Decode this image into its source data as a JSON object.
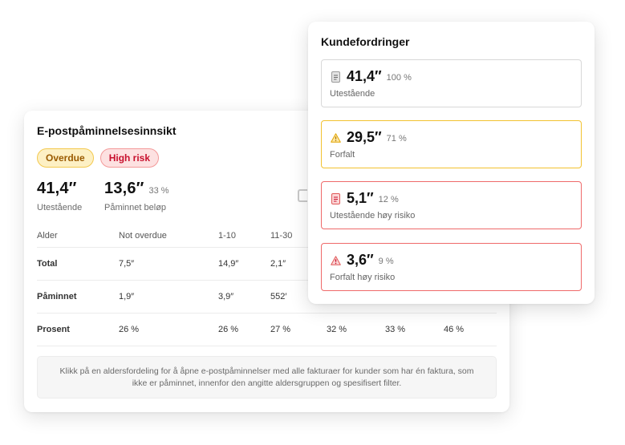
{
  "reminder_card": {
    "title": "E-postpåminnelsesinnsikt",
    "badges": {
      "overdue": "Overdue",
      "high_risk": "High risk"
    },
    "stats": [
      {
        "value": "41,4″",
        "pct": "",
        "label": "Utestående"
      },
      {
        "value": "13,6″",
        "pct": "33 %",
        "label": "Påminnet beløp"
      }
    ],
    "table": {
      "headers": [
        "Alder",
        "Not overdue",
        "1-10",
        "11-30",
        "",
        ""
      ],
      "rows": [
        {
          "label": "Total",
          "cells": [
            "7,5″",
            "14,9″",
            "2,1″",
            "",
            ""
          ]
        },
        {
          "label": "Påminnet",
          "cells": [
            "1,9″",
            "3,9″",
            "552′",
            "",
            ""
          ]
        },
        {
          "label": "Prosent",
          "cells": [
            "26 %",
            "26 %",
            "27 %",
            "32 %",
            "33 %",
            "46 %"
          ]
        }
      ]
    },
    "note": "Klikk på en aldersfordeling for å åpne e-postpåminnelser med alle fakturaer for kunder som har én faktura, som ikke er påminnet, innenfor den angitte aldersgruppen og spesifisert filter."
  },
  "receivables_card": {
    "title": "Kundefordringer",
    "items": [
      {
        "icon": "document-icon",
        "value": "41,4″",
        "pct": "100 %",
        "label": "Utestående",
        "color": "#d8d8d8"
      },
      {
        "icon": "warning-icon",
        "value": "29,5″",
        "pct": "71 %",
        "label": "Forfalt",
        "color": "#f2c230"
      },
      {
        "icon": "document-icon",
        "value": "5,1″",
        "pct": "12 %",
        "label": "Utestående høy risiko",
        "color": "#ef6a6a"
      },
      {
        "icon": "warning-icon",
        "value": "3,6″",
        "pct": "9 %",
        "label": "Forfalt høy risiko",
        "color": "#ef6a6a"
      }
    ]
  }
}
